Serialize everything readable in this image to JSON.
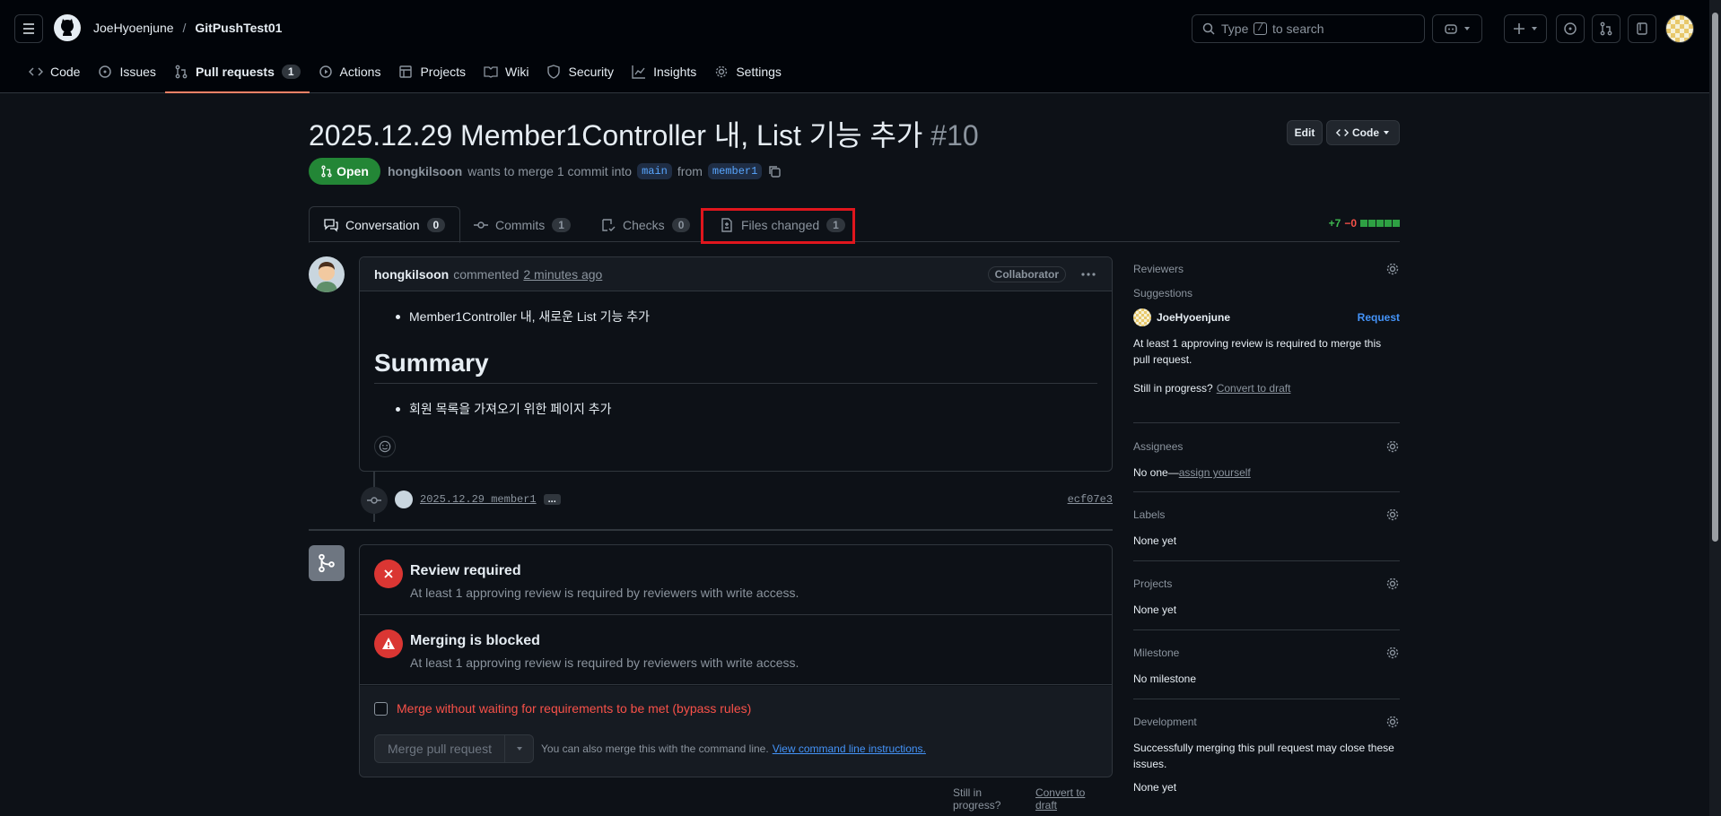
{
  "header": {
    "owner": "JoeHyoenjune",
    "separator": "/",
    "repo": "GitPushTest01",
    "search_placeholder": "Type / to search",
    "search_prefix": "Type",
    "search_key": "/",
    "search_suffix": "to search"
  },
  "repo_tabs": [
    {
      "label": "Code",
      "icon": "code-icon"
    },
    {
      "label": "Issues",
      "icon": "issue-icon"
    },
    {
      "label": "Pull requests",
      "icon": "pull-request-icon",
      "count": "1",
      "selected": true
    },
    {
      "label": "Actions",
      "icon": "play-icon"
    },
    {
      "label": "Projects",
      "icon": "table-icon"
    },
    {
      "label": "Wiki",
      "icon": "book-icon"
    },
    {
      "label": "Security",
      "icon": "shield-icon"
    },
    {
      "label": "Insights",
      "icon": "graph-icon"
    },
    {
      "label": "Settings",
      "icon": "gear-icon"
    }
  ],
  "pr": {
    "title": "2025.12.29 Member1Controller 내, List 기능 추가",
    "number": "#10",
    "edit_label": "Edit",
    "code_label": "Code",
    "status": "Open",
    "author": "hongkilsoon",
    "merge_text": "wants to merge 1 commit into",
    "base_branch": "main",
    "from_text": "from",
    "head_branch": "member1"
  },
  "pr_tabs": [
    {
      "label": "Conversation",
      "count": "0",
      "icon": "comment-icon"
    },
    {
      "label": "Commits",
      "count": "1",
      "icon": "commit-icon"
    },
    {
      "label": "Checks",
      "count": "0",
      "icon": "checklist-icon"
    },
    {
      "label": "Files changed",
      "count": "1",
      "icon": "file-diff-icon"
    }
  ],
  "diffstat": {
    "additions": "+7",
    "deletions": "−0"
  },
  "comment": {
    "author": "hongkilsoon",
    "action": "commented",
    "time": "2 minutes ago",
    "badge": "Collaborator",
    "bullet1": "Member1Controller 내, 새로운 List 기능 추가",
    "heading": "Summary",
    "bullet2": "회원 목록을 가져오기 위한 페이지 추가"
  },
  "commit": {
    "message": "2025.12.29 member1",
    "more": "...",
    "sha": "ecf07e3"
  },
  "merge_box": {
    "review_title": "Review required",
    "review_desc": "At least 1 approving review is required by reviewers with write access.",
    "blocked_title": "Merging is blocked",
    "blocked_desc": "At least 1 approving review is required by reviewers with write access.",
    "bypass_label": "Merge without waiting for requirements to be met (bypass rules)",
    "merge_button": "Merge pull request",
    "cli_text": "You can also merge this with the command line.",
    "cli_link": "View command line instructions.",
    "still_text": "Still in progress?",
    "draft_link": "Convert to draft"
  },
  "sidebar": {
    "reviewers": {
      "title": "Reviewers",
      "suggestions": "Suggestions",
      "user": "JoeHyoenjune",
      "request": "Request",
      "note": "At least 1 approving review is required to merge this pull request.",
      "still": "Still in progress?",
      "draft": "Convert to draft"
    },
    "assignees": {
      "title": "Assignees",
      "none": "No one—",
      "link": "assign yourself"
    },
    "labels": {
      "title": "Labels",
      "value": "None yet"
    },
    "projects": {
      "title": "Projects",
      "value": "None yet"
    },
    "milestone": {
      "title": "Milestone",
      "value": "No milestone"
    },
    "development": {
      "title": "Development",
      "note": "Successfully merging this pull request may close these issues.",
      "value": "None yet"
    }
  },
  "colors": {
    "green": "#238636",
    "red": "#da3633",
    "link": "#4493f8",
    "accent": "#f78166",
    "highlight": "#e0161d"
  }
}
